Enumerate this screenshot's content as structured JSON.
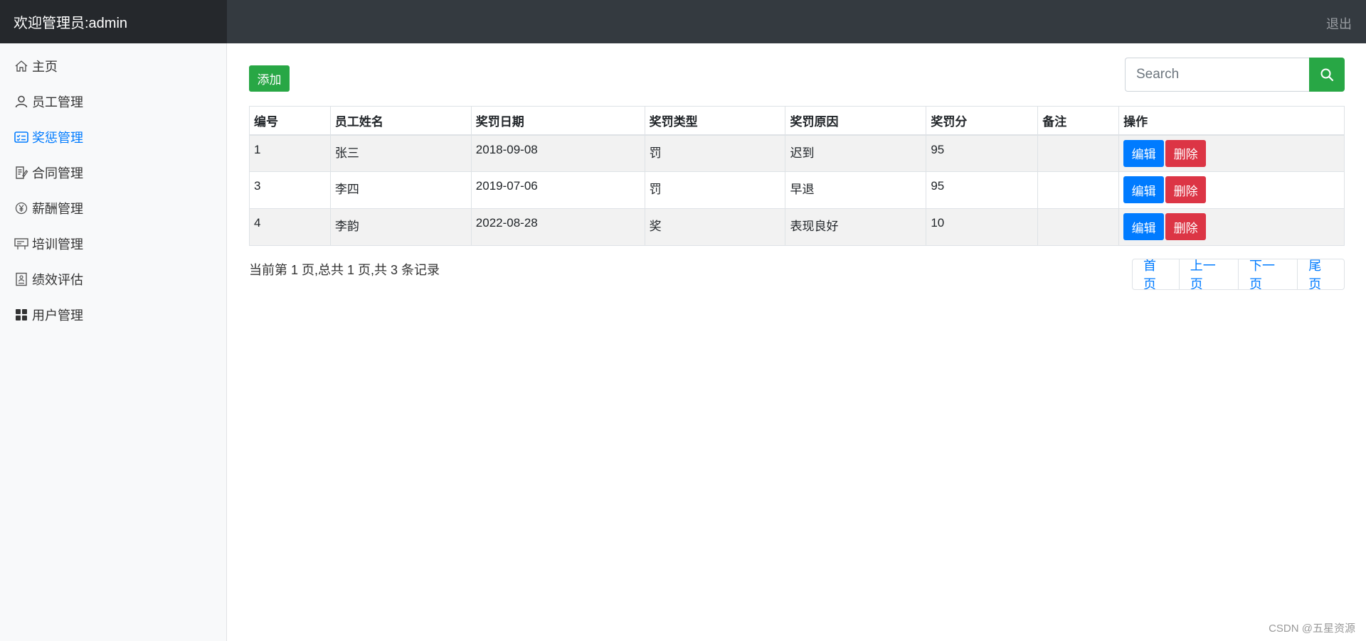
{
  "header": {
    "brand": "欢迎管理员:admin",
    "logout": "退出"
  },
  "sidebar": {
    "items": [
      {
        "label": "主页",
        "icon": "home-icon",
        "active": false
      },
      {
        "label": "员工管理",
        "icon": "user-icon",
        "active": false
      },
      {
        "label": "奖惩管理",
        "icon": "checklist-icon",
        "active": true
      },
      {
        "label": "合同管理",
        "icon": "contract-icon",
        "active": false
      },
      {
        "label": "薪酬管理",
        "icon": "yen-icon",
        "active": false
      },
      {
        "label": "培训管理",
        "icon": "training-icon",
        "active": false
      },
      {
        "label": "绩效评估",
        "icon": "evaluation-icon",
        "active": false
      },
      {
        "label": "用户管理",
        "icon": "grid-icon",
        "active": false
      }
    ]
  },
  "toolbar": {
    "add_label": "添加",
    "search_placeholder": "Search"
  },
  "table": {
    "columns": [
      "编号",
      "员工姓名",
      "奖罚日期",
      "奖罚类型",
      "奖罚原因",
      "奖罚分",
      "备注",
      "操作"
    ],
    "rows": [
      {
        "id": "1",
        "name": "张三",
        "date": "2018-09-08",
        "type": "罚",
        "reason": "迟到",
        "score": "95",
        "note": ""
      },
      {
        "id": "3",
        "name": "李四",
        "date": "2019-07-06",
        "type": "罚",
        "reason": "早退",
        "score": "95",
        "note": ""
      },
      {
        "id": "4",
        "name": "李韵",
        "date": "2022-08-28",
        "type": "奖",
        "reason": "表现良好",
        "score": "10",
        "note": ""
      }
    ],
    "edit_label": "编辑",
    "delete_label": "删除"
  },
  "pagination": {
    "info": "当前第 1 页,总共 1 页,共 3 条记录",
    "first": "首页",
    "prev": "上一页",
    "next": "下一页",
    "last": "尾页"
  },
  "watermark": "CSDN @五星资源",
  "colors": {
    "primary": "#007bff",
    "success": "#28a745",
    "danger": "#dc3545",
    "header": "#343a40"
  }
}
